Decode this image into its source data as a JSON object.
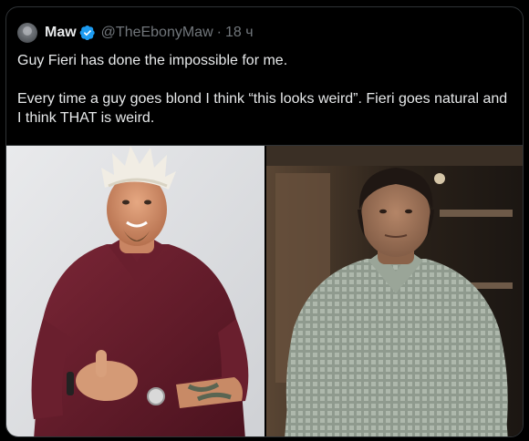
{
  "tweet": {
    "display_name": "Maw",
    "handle": "@TheEbonyMaw",
    "separator": "·",
    "time": "18 ч",
    "paragraphs": [
      "Guy Fieri has done the impossible for me.",
      "Every time a guy goes blond I think “this looks weird”. Fieri goes natural and I think THAT is weird."
    ]
  },
  "icons": {
    "verified": "verified-badge-icon"
  },
  "colors": {
    "background": "#000000",
    "text_primary": "#e7e9ea",
    "text_secondary": "#71767b",
    "verified_blue": "#1d9bf0",
    "border": "#2f3336"
  },
  "media": [
    {
      "kind": "photo",
      "subject": "man with spiky bleached hair in maroon shirt"
    },
    {
      "kind": "photo",
      "subject": "man with dark hair in checked shirt"
    }
  ]
}
